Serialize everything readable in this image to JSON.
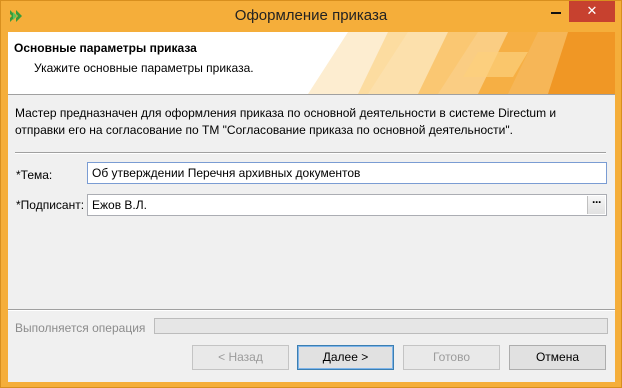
{
  "window": {
    "title": "Оформление приказа",
    "accent_color": "#f5ae3a",
    "close_color": "#c7412f",
    "icons": {
      "app": "directum-arrows-icon",
      "minimize": "minimize-icon",
      "close": "close-icon"
    },
    "close_glyph": "✕"
  },
  "header": {
    "title": "Основные параметры приказа",
    "subtitle": "Укажите основные параметры приказа."
  },
  "description": "Мастер предназначен для оформления приказа по основной деятельности в системе Directum и отправки его на согласование по ТМ \"Согласование приказа по основной деятельности\".",
  "form": {
    "topic": {
      "label": "*Тема:",
      "value": "Об утверждении Перечня архивных документов"
    },
    "signer": {
      "label": "*Подписант:",
      "value": "Ежов В.Л.",
      "picker_glyph": "···"
    }
  },
  "progress": {
    "label": "Выполняется операция",
    "value": 0,
    "enabled": false
  },
  "buttons": {
    "back": {
      "label": "< Назад",
      "enabled": false
    },
    "next": {
      "label": "Далее >",
      "enabled": true
    },
    "finish": {
      "label": "Готово",
      "enabled": false
    },
    "cancel": {
      "label": "Отмена",
      "enabled": true
    }
  }
}
